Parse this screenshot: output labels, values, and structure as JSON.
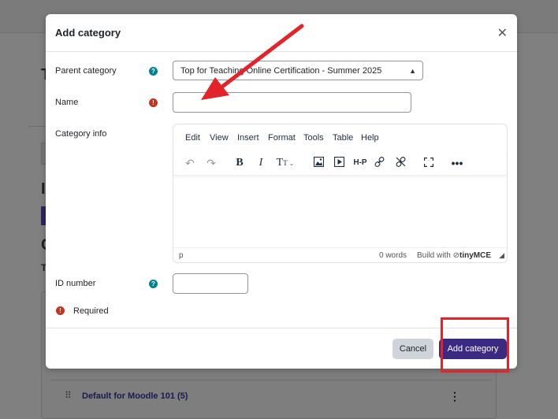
{
  "background": {
    "fragments": [
      "T",
      "I",
      "C",
      "T"
    ],
    "row": {
      "title": "Default for Moodle 101 (5)",
      "drag_icon": "drag-handle-icon",
      "menu_icon": "kebab-menu-icon"
    }
  },
  "modal": {
    "title": "Add category",
    "close_icon": "close-icon",
    "fields": {
      "parent": {
        "label": "Parent category",
        "value": "Top for Teaching Online Certification - Summer 2025",
        "help_icon": "help-icon"
      },
      "name": {
        "label": "Name",
        "value": "",
        "required_icon": "required-icon"
      },
      "info": {
        "label": "Category info"
      },
      "id_number": {
        "label": "ID number",
        "value": "",
        "help_icon": "help-icon"
      }
    },
    "required_note": "Required",
    "editor": {
      "menu": [
        "Edit",
        "View",
        "Insert",
        "Format",
        "Tools",
        "Table",
        "Help"
      ],
      "toolbar": [
        "undo-icon",
        "redo-icon",
        "bold-icon",
        "italic-icon",
        "font-size-icon",
        "image-icon",
        "media-icon",
        "h5p-icon",
        "link-icon",
        "unlink-icon",
        "fullscreen-icon",
        "more-icon"
      ],
      "status_path": "p",
      "word_count": "0 words",
      "built_with": "Build with",
      "brand": "tinyMCE"
    },
    "buttons": {
      "cancel": "Cancel",
      "add": "Add category"
    }
  },
  "annotations": {
    "arrow_color": "#e3232a",
    "box_color": "#e3232a"
  }
}
